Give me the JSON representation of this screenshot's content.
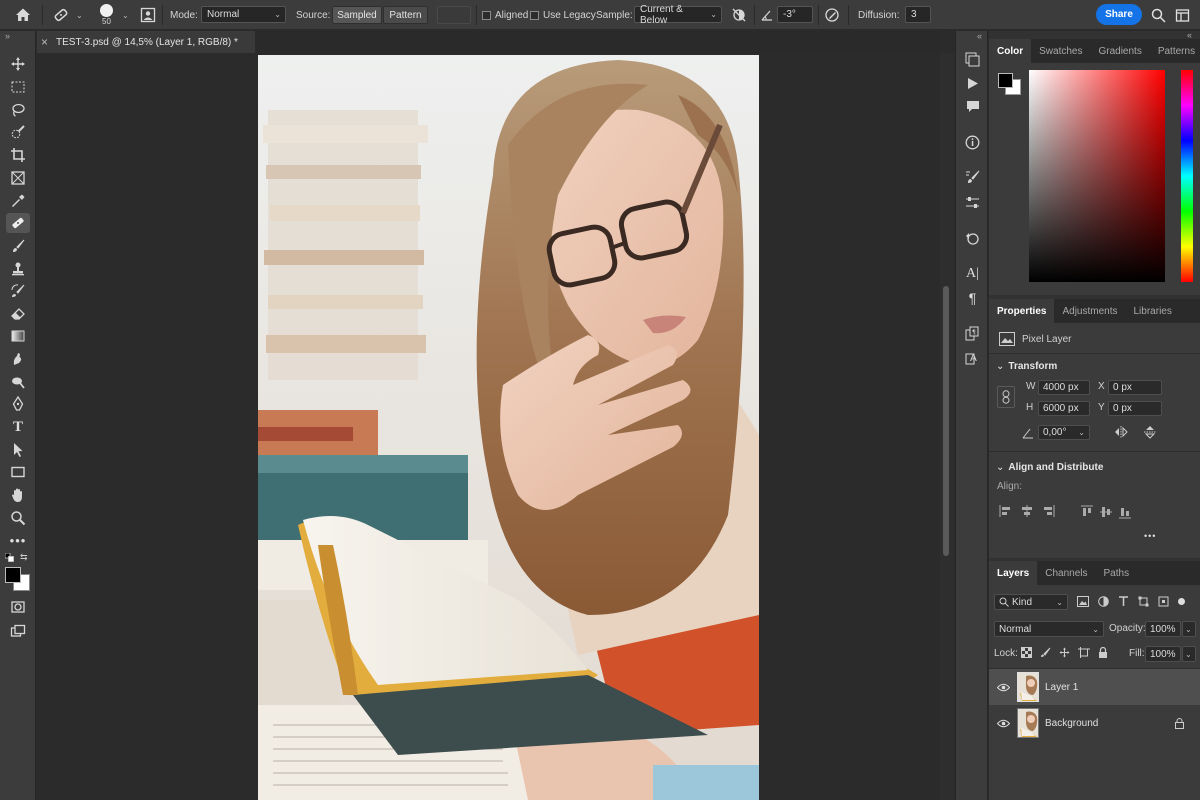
{
  "options_bar": {
    "brush_size": "50",
    "mode_label": "Mode:",
    "mode_value": "Normal",
    "source_label": "Source:",
    "source_sampled": "Sampled",
    "source_pattern": "Pattern",
    "aligned_label": "Aligned",
    "use_legacy_label": "Use Legacy",
    "sample_label": "Sample:",
    "sample_value": "Current & Below",
    "angle_value": "-3°",
    "diffusion_label": "Diffusion:",
    "diffusion_value": "3",
    "share_label": "Share"
  },
  "document": {
    "tab_title": "TEST-3.psd @ 14,5% (Layer 1, RGB/8) *",
    "close_glyph": "×"
  },
  "color_panel": {
    "tabs": [
      "Color",
      "Swatches",
      "Gradients",
      "Patterns"
    ],
    "foreground": "#000000",
    "background": "#ffffff",
    "hue_color": "#ff0000"
  },
  "properties_panel": {
    "tabs": [
      "Properties",
      "Adjustments",
      "Libraries"
    ],
    "layer_kind": "Pixel Layer",
    "transform_title": "Transform",
    "w_label": "W",
    "w_value": "4000 px",
    "h_label": "H",
    "h_value": "6000 px",
    "x_label": "X",
    "x_value": "0 px",
    "y_label": "Y",
    "y_value": "0 px",
    "angle_value": "0,00°",
    "align_title": "Align and Distribute",
    "align_label": "Align:",
    "more_glyph": "•••"
  },
  "layers_panel": {
    "tabs": [
      "Layers",
      "Channels",
      "Paths"
    ],
    "filter_kind": "Kind",
    "blend_mode": "Normal",
    "opacity_label": "Opacity:",
    "opacity_value": "100%",
    "lock_label": "Lock:",
    "fill_label": "Fill:",
    "fill_value": "100%",
    "layers": [
      {
        "name": "Layer 1",
        "selected": true,
        "locked": false
      },
      {
        "name": "Background",
        "selected": false,
        "locked": true
      }
    ]
  },
  "accent_color": "#1473e6"
}
